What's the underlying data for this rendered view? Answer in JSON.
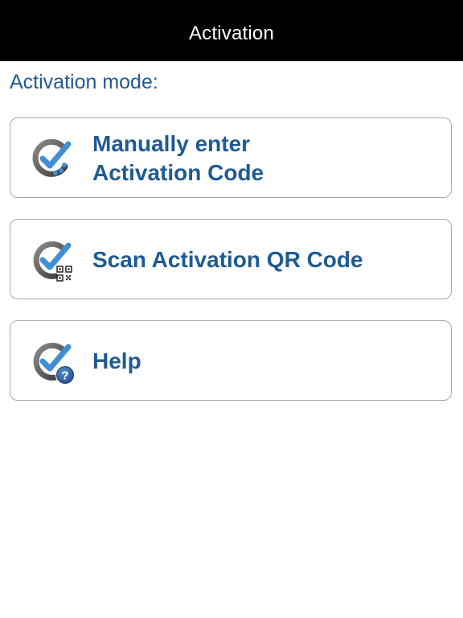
{
  "header": {
    "title": "Activation"
  },
  "main": {
    "section_label": "Activation mode:",
    "options": [
      {
        "id": "manual",
        "label_lines": [
          "Manually enter",
          "Activation Code"
        ],
        "icon": "check-dots-icon"
      },
      {
        "id": "scan",
        "label_lines": [
          "Scan Activation QR Code"
        ],
        "icon": "check-qr-icon"
      },
      {
        "id": "help",
        "label_lines": [
          "Help"
        ],
        "icon": "check-help-icon"
      }
    ],
    "help_badge_glyph": "?"
  },
  "colors": {
    "brand_blue": "#1f5a93",
    "check_blue": "#3f8fd2",
    "ring_gray": "#5a5a5a",
    "card_border": "#a8a8a8",
    "header_bg": "#000000"
  }
}
